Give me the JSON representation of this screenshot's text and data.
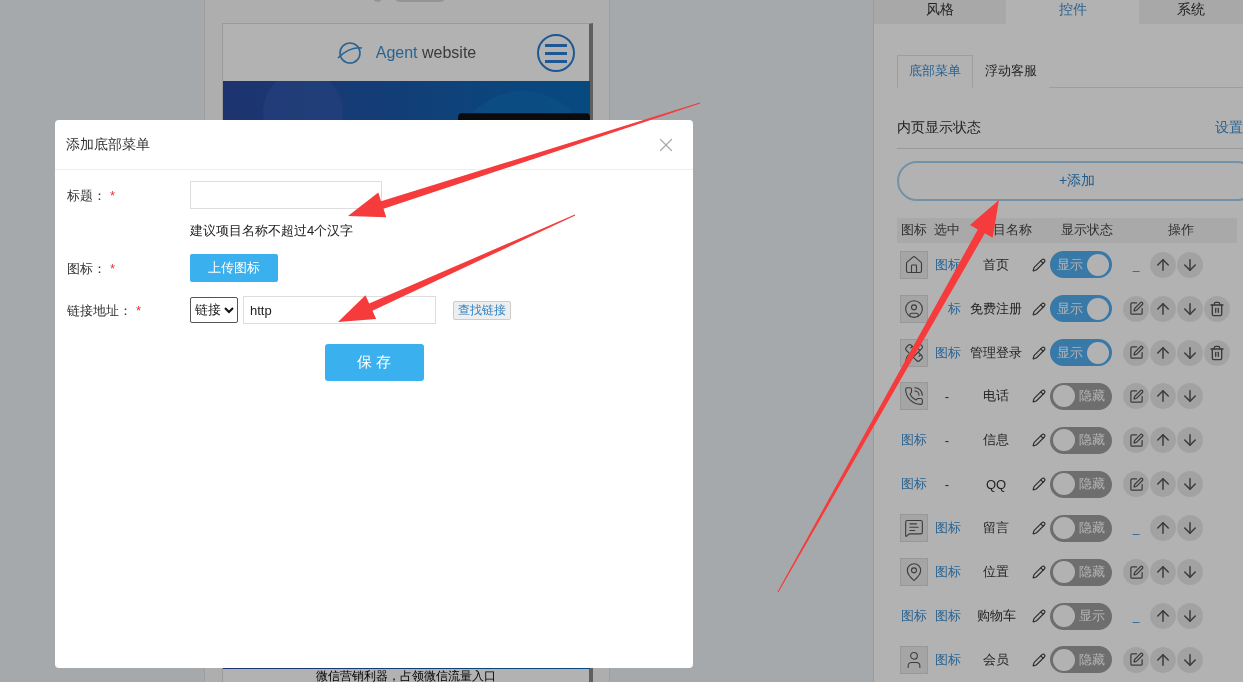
{
  "phone_preview": {
    "logo_accent": "Agent",
    "logo_text": "website",
    "footer_text": "微信营销利器，占领微信流量入口"
  },
  "settings_panel": {
    "tabs": [
      {
        "label": "风格",
        "selected": false
      },
      {
        "label": "控件",
        "selected": true
      },
      {
        "label": "系统",
        "selected": false
      }
    ],
    "sub_tabs": [
      {
        "label": "底部菜单",
        "selected": true
      },
      {
        "label": "浮动客服",
        "selected": false
      }
    ],
    "inner_status": {
      "label": "内页显示状态",
      "action": "设置"
    },
    "add_button": "+添加",
    "table": {
      "columns": [
        "图标",
        "选中",
        "目名称",
        "显示状态",
        "操作"
      ],
      "rows": [
        {
          "checked_cell": {
            "kind": "link",
            "text": "图标"
          },
          "name": "首页",
          "shown": true,
          "toggle_label": "显示",
          "action": {
            "kind": "link",
            "text": "_"
          },
          "deletable": false
        },
        {
          "checked_cell": {
            "kind": "link",
            "text": "标"
          },
          "name": "免费注册",
          "shown": true,
          "toggle_label": "显示",
          "action": {
            "kind": "edit"
          },
          "deletable": true
        },
        {
          "checked_cell": {
            "kind": "link",
            "text": "图标"
          },
          "name": "管理登录",
          "shown": true,
          "toggle_label": "显示",
          "action": {
            "kind": "edit"
          },
          "deletable": true
        },
        {
          "checked_cell": {
            "kind": "text",
            "text": "-"
          },
          "name": "电话",
          "shown": false,
          "toggle_label": "隐藏",
          "action": {
            "kind": "edit"
          },
          "deletable": false
        },
        {
          "icon": {
            "kind": "link",
            "text": "图标"
          },
          "checked_cell": {
            "kind": "text",
            "text": "-"
          },
          "name": "信息",
          "shown": false,
          "toggle_label": "隐藏",
          "action": {
            "kind": "edit"
          },
          "deletable": false
        },
        {
          "icon": {
            "kind": "link",
            "text": "图标"
          },
          "checked_cell": {
            "kind": "text",
            "text": "-"
          },
          "name": "QQ",
          "shown": false,
          "toggle_label": "隐藏",
          "action": {
            "kind": "edit"
          },
          "deletable": false
        },
        {
          "checked_cell": {
            "kind": "link",
            "text": "图标"
          },
          "name": "留言",
          "shown": false,
          "toggle_label": "隐藏",
          "action": {
            "kind": "link",
            "text": "_"
          },
          "deletable": false
        },
        {
          "checked_cell": {
            "kind": "link",
            "text": "图标"
          },
          "name": "位置",
          "shown": false,
          "toggle_label": "隐藏",
          "action": {
            "kind": "edit"
          },
          "deletable": false
        },
        {
          "icon": {
            "kind": "link",
            "text": "图标"
          },
          "checked_cell": {
            "kind": "link",
            "text": "图标"
          },
          "name": "购物车",
          "shown": false,
          "toggle_label": "显示",
          "action": {
            "kind": "link",
            "text": "_"
          },
          "deletable": false
        },
        {
          "checked_cell": {
            "kind": "link",
            "text": "图标"
          },
          "name": "会员",
          "shown": false,
          "toggle_label": "隐藏",
          "action": {
            "kind": "edit"
          },
          "deletable": false
        }
      ]
    }
  },
  "dialog": {
    "title": "添加底部菜单",
    "fields": [
      {
        "kind": "text",
        "label": "标题：",
        "required_mark": "*",
        "hint": "建议项目名称不超过4个汉字"
      },
      {
        "kind": "upload",
        "label": "图标：",
        "required_mark": "*",
        "button": "上传图标"
      },
      {
        "kind": "link",
        "label": "链接地址：",
        "required_mark": "*",
        "select": "链接",
        "value": "http",
        "button": "查找链接"
      }
    ],
    "save_button": "保 存"
  }
}
